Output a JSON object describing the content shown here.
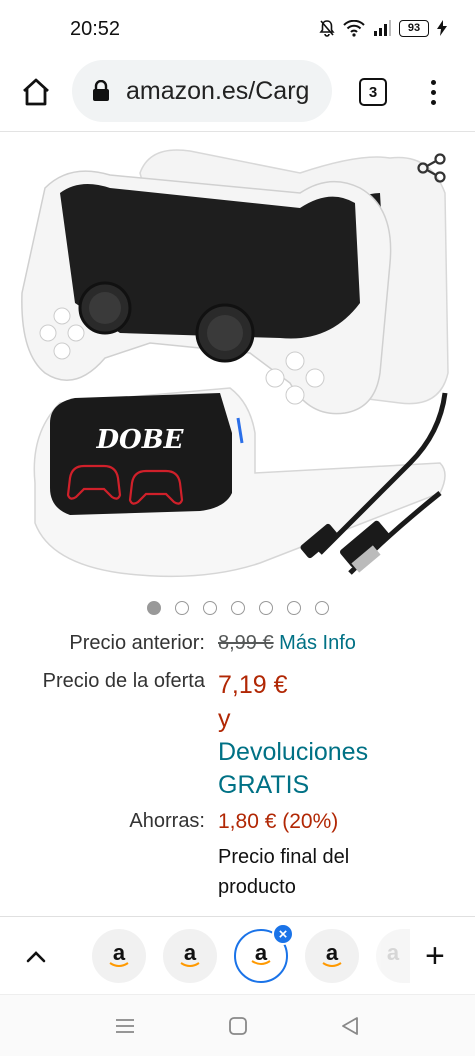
{
  "status_bar": {
    "time": "20:52",
    "battery": "93",
    "icons": [
      "mute-icon",
      "wifi-icon",
      "signal-icon",
      "battery-icon",
      "charging-icon"
    ]
  },
  "browser": {
    "url": "amazon.es/Carg",
    "tab_count": "3",
    "icons": [
      "home-icon",
      "lock-icon",
      "more-vert-icon"
    ]
  },
  "product": {
    "image_logo_text": "DOBE",
    "carousel_pages": 7,
    "carousel_active": 1
  },
  "pricing": {
    "previous_label": "Precio anterior:",
    "previous_value": "8,99 €",
    "more_info": "Más Info",
    "deal_label": "Precio de la oferta",
    "deal_value": "7,19 €",
    "and": "y",
    "returns_line1": "Devoluciones",
    "returns_line2": "GRATIS",
    "savings_label": "Ahorras:",
    "savings_value": "1,80 € (20%)",
    "final_line1": "Precio final del",
    "final_line2": "producto"
  },
  "tab_strip": {
    "favicon_letter": "a",
    "tabs": 5,
    "current_tab": 3
  },
  "colors": {
    "link": "#007185",
    "price": "#b12704",
    "accent": "#1a73e8"
  }
}
